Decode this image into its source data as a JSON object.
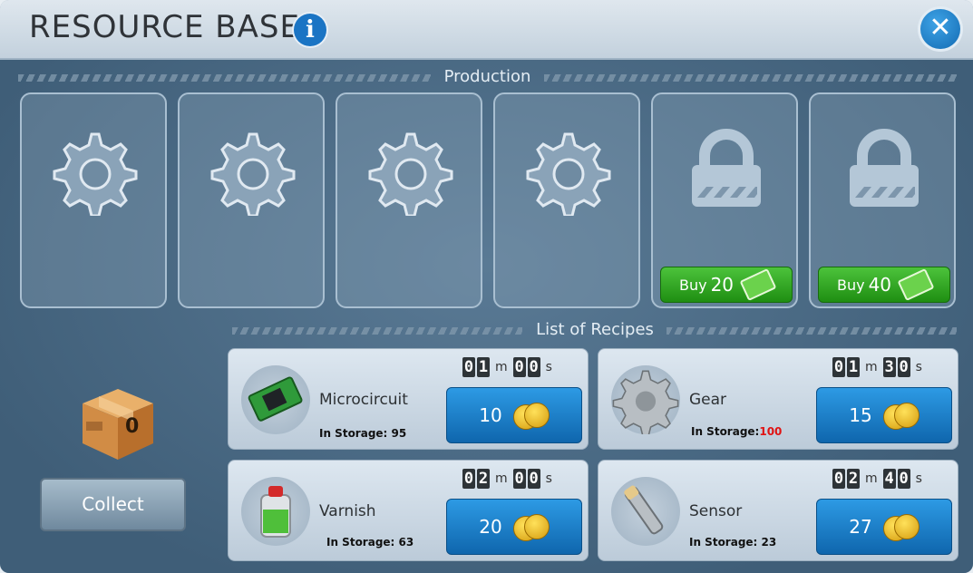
{
  "window": {
    "title": "RESOURCE BASE"
  },
  "production": {
    "label": "Production",
    "slots": [
      {
        "state": "empty",
        "icon": "gear-icon"
      },
      {
        "state": "empty",
        "icon": "gear-icon"
      },
      {
        "state": "empty",
        "icon": "gear-icon"
      },
      {
        "state": "empty",
        "icon": "gear-icon"
      },
      {
        "state": "locked",
        "icon": "lock-icon",
        "buy_label": "Buy",
        "buy_price": "20"
      },
      {
        "state": "locked",
        "icon": "lock-icon",
        "buy_label": "Buy",
        "buy_price": "40"
      }
    ]
  },
  "recipes": {
    "label": "List of Recipes",
    "items": [
      {
        "name": "Microcircuit",
        "storage_label": "In Storage:",
        "storage_value": "95",
        "timer": [
          "0",
          "1",
          "0",
          "0"
        ],
        "price": "10"
      },
      {
        "name": "Gear",
        "storage_label": "In Storage:",
        "storage_value": "100",
        "timer": [
          "0",
          "1",
          "3",
          "0"
        ],
        "price": "15"
      },
      {
        "name": "Varnish",
        "storage_label": "In Storage:",
        "storage_value": "63",
        "timer": [
          "0",
          "2",
          "0",
          "0"
        ],
        "price": "20"
      },
      {
        "name": "Sensor",
        "storage_label": "In Storage:",
        "storage_value": "23",
        "timer": [
          "0",
          "2",
          "4",
          "0"
        ],
        "price": "27"
      }
    ],
    "timer_units": {
      "minutes": "m",
      "seconds": "s"
    }
  },
  "collect": {
    "count": "0",
    "button_label": "Collect"
  },
  "colors": {
    "buy_green": "#2ea620",
    "price_blue": "#1d7fcb",
    "full_storage_red": "#e01313"
  }
}
